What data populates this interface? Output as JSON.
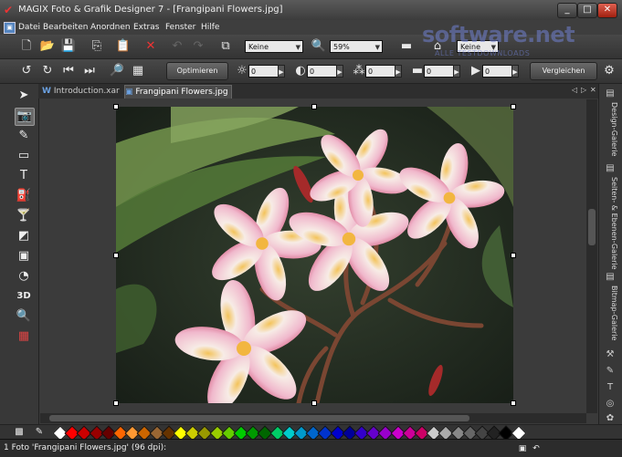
{
  "window": {
    "title": "MAGIX Foto & Grafik Designer 7 - [Frangipani Flowers.jpg]",
    "minimize": "_",
    "maximize": "□",
    "close": "✕"
  },
  "menu": [
    "Datei",
    "Bearbeiten",
    "Anordnen",
    "Extras",
    "Fenster",
    "Hilfe"
  ],
  "toolbar": {
    "view_combo": "Keine",
    "zoom_combo": "59%",
    "style_combo": "Keine",
    "optimize_button": "Optimieren",
    "compare_button": "Vergleichen",
    "brightness": "0",
    "contrast": "0",
    "saturation": "0",
    "temperature": "0",
    "sharpness": "0"
  },
  "watermark": {
    "text": "software.net",
    "sub": "ALLE TESTDOWNLOADS"
  },
  "tabs": [
    {
      "label": "Introduction.xar",
      "close": "✕"
    },
    {
      "label": "Frangipani Flowers.jpg",
      "close": "✕"
    }
  ],
  "tab_nav": {
    "prev": "◁",
    "next": "▷",
    "close": "✕"
  },
  "right_panel": [
    "Design-Galerie",
    "Seiten- & Ebenen-Galerie",
    "Bitmap-Galerie"
  ],
  "status": {
    "text": "1 Foto 'Frangipani Flowers.jpg' (96 dpi):"
  },
  "colors": {
    "accent": "#4a7fc0",
    "close": "#c0392b"
  },
  "palette": [
    "#ffffff",
    "#ff0000",
    "#cc0000",
    "#990000",
    "#660000",
    "#ff6600",
    "#ff9933",
    "#cc6600",
    "#996633",
    "#663300",
    "#ffff00",
    "#cccc00",
    "#999900",
    "#99cc00",
    "#66cc00",
    "#00cc00",
    "#009900",
    "#006600",
    "#00cc66",
    "#00cccc",
    "#0099cc",
    "#0066cc",
    "#0033cc",
    "#0000cc",
    "#000099",
    "#3300cc",
    "#6600cc",
    "#9900cc",
    "#cc00cc",
    "#cc0099",
    "#cc0066",
    "#cccccc",
    "#aaaaaa",
    "#888888",
    "#666666",
    "#444444",
    "#222222",
    "#000000",
    "#ffffff"
  ]
}
